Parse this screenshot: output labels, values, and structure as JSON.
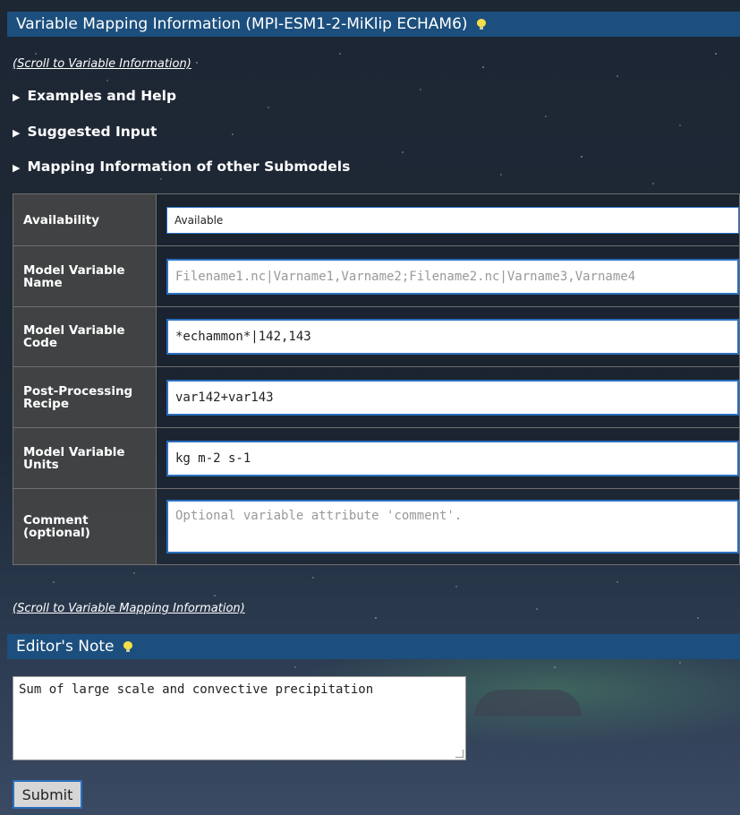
{
  "header": {
    "title": "Variable Mapping Information (MPI-ESM1-2-MiKlip ECHAM6)"
  },
  "links": {
    "scroll_to_info": "(Scroll to Variable Information)",
    "scroll_to_mapping": "(Scroll to Variable Mapping Information)"
  },
  "sections": [
    {
      "label": "Examples and Help"
    },
    {
      "label": "Suggested Input"
    },
    {
      "label": "Mapping Information of other Submodels"
    }
  ],
  "rows": [
    {
      "label": "Availability",
      "value": "Available"
    },
    {
      "label": "Model Variable Name",
      "placeholder": "Filename1.nc|Varname1,Varname2;Filename2.nc|Varname3,Varname4"
    },
    {
      "label": "Model Variable Code",
      "value": "*echammon*|142,143"
    },
    {
      "label": "Post-Processing Recipe",
      "value": "var142+var143"
    },
    {
      "label": "Model Variable Units",
      "value": "kg m-2 s-1"
    },
    {
      "label": "Comment (optional)",
      "placeholder": "Optional variable attribute 'comment'."
    }
  ],
  "editor": {
    "title": "Editor's Note",
    "text": "Sum of large scale and convective precipitation",
    "submit_label": "Submit"
  },
  "icons": {
    "bulb": "lightbulb-icon",
    "disclosure": "triangle-right-icon"
  },
  "colors": {
    "header_bar": "#1c4f7d",
    "field_border": "#2a6fbf",
    "label_bg": "#464646"
  }
}
